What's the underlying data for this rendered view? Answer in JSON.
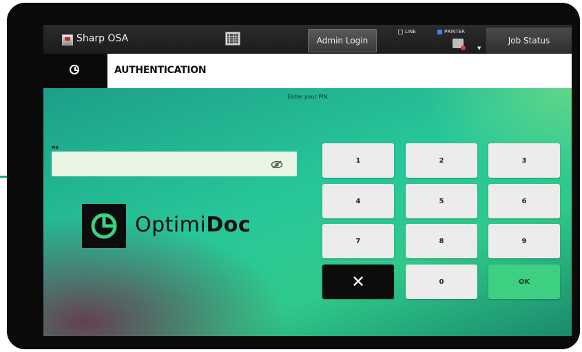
{
  "statusbar": {
    "app_title": "Sharp OSA",
    "admin_login_label": "Admin Login",
    "line_label": "LINE",
    "printer_label": "PRINTER",
    "job_status_label": "Job Status"
  },
  "header": {
    "title": "AUTHENTICATION"
  },
  "auth": {
    "prompt": "Enter your PIN",
    "pin_label": "PIN",
    "pin_value": ""
  },
  "brand": {
    "name_light": "Optimi",
    "name_bold": "Doc"
  },
  "keypad": {
    "keys": [
      "1",
      "2",
      "3",
      "4",
      "5",
      "6",
      "7",
      "8",
      "9",
      "✕",
      "0",
      "OK"
    ]
  },
  "colors": {
    "accent": "#3dd083",
    "indicator_printer": "#2f8fe0"
  },
  "icons": {
    "app": "app-icon",
    "keyboard": "keyboard-icon",
    "printer": "printer-icon",
    "home": "home-icon",
    "eye": "eye-icon",
    "brand": "optimidoc-logo-icon"
  }
}
